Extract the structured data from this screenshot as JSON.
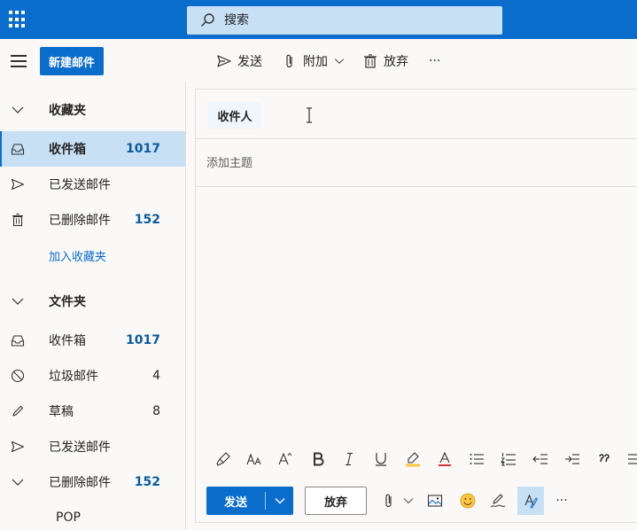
{
  "topbar": {
    "search_placeholder": "搜索"
  },
  "commandbar": {
    "new_mail_label": "新建邮件",
    "send_label": "发送",
    "attach_label": "附加",
    "discard_label": "放弃",
    "more_label": "···"
  },
  "sidebar": {
    "favorites": {
      "label": "收藏夹",
      "items": [
        {
          "label": "收件箱",
          "count": "1017"
        },
        {
          "label": "已发送邮件",
          "count": ""
        },
        {
          "label": "已删除邮件",
          "count": "152"
        }
      ],
      "add_favorite_label": "加入收藏夹"
    },
    "folders": {
      "label": "文件夹",
      "items": [
        {
          "label": "收件箱",
          "count": "1017"
        },
        {
          "label": "垃圾邮件",
          "count": "4"
        },
        {
          "label": "草稿",
          "count": "8"
        },
        {
          "label": "已发送邮件",
          "count": ""
        },
        {
          "label": "已删除邮件",
          "count": "152"
        },
        {
          "label": "POP",
          "count": ""
        }
      ]
    }
  },
  "compose": {
    "to_label": "收件人",
    "subject_placeholder": "添加主题",
    "send_label": "发送",
    "discard_label": "放弃",
    "more_label": "···"
  },
  "colors": {
    "accent": "#0a6ccb",
    "selected_bg": "#c7e0f4",
    "background": "#faf9f8"
  }
}
